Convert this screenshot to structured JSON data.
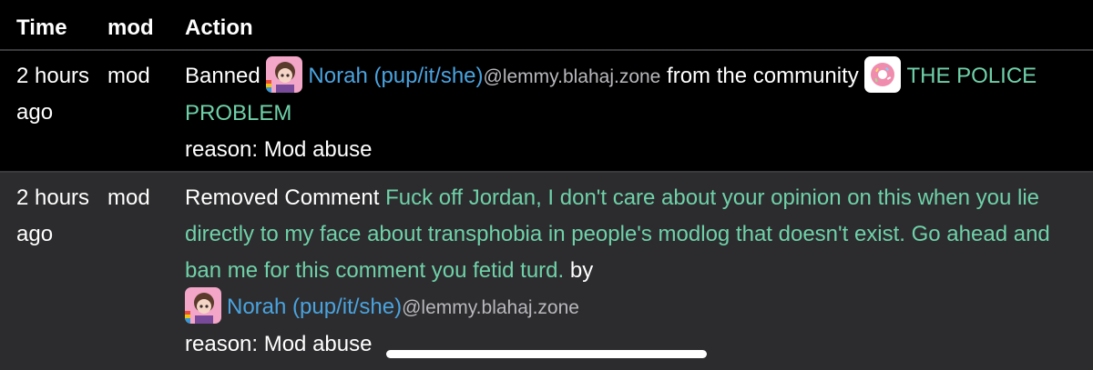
{
  "columns": {
    "time": "Time",
    "mod": "mod",
    "action": "Action"
  },
  "rows": [
    {
      "time": "2 hours ago",
      "mod": "mod",
      "verb": "Banned",
      "user_name": "Norah (pup/it/she)",
      "user_instance": "@lemmy.blahaj.zone",
      "connector": "from the community",
      "community": "THE POLICE PROBLEM",
      "reason": "reason: Mod abuse"
    },
    {
      "time": "2 hours ago",
      "mod": "mod",
      "verb": "Removed Comment",
      "comment": "Fuck off Jordan, I don't care about your opinion on this when you lie directly to my face about transphobia in people's modlog that doesn't exist. Go ahead and ban me for this comment you fetid turd.",
      "by": "by",
      "user_name": "Norah (pup/it/she)",
      "user_instance": "@lemmy.blahaj.zone",
      "reason": "reason: Mod abuse"
    }
  ],
  "colors": {
    "link_blue": "#4aa3df",
    "link_green": "#6fd1a9",
    "row_alt": "#2c2c2e"
  }
}
